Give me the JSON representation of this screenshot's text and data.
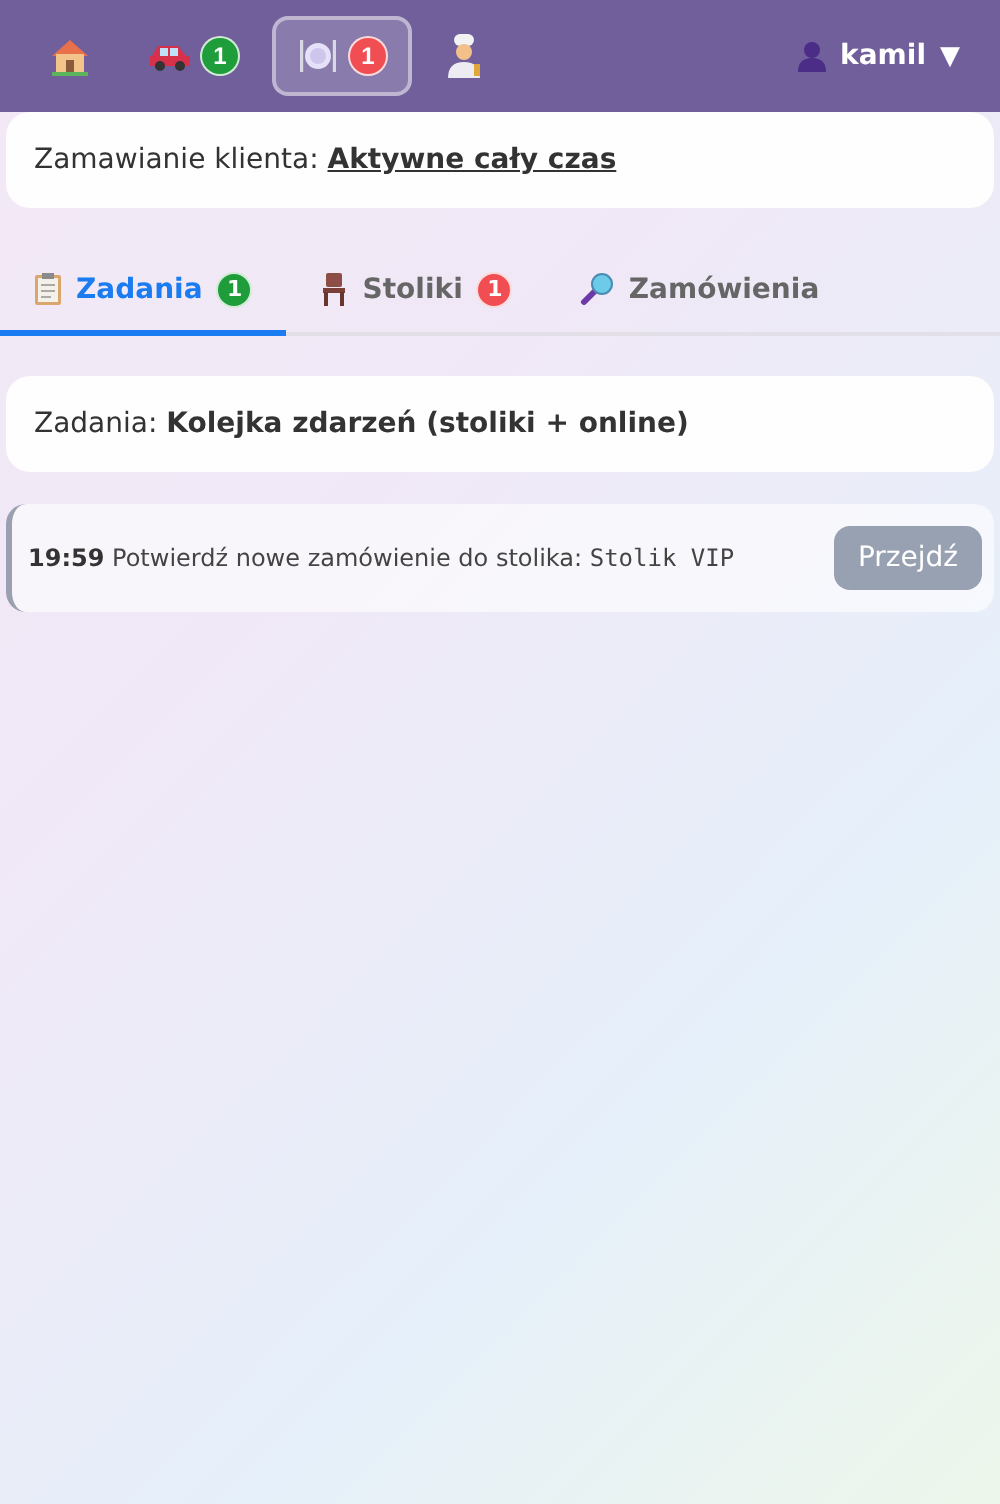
{
  "nav": {
    "items": [
      {
        "kind": "house",
        "selected": false
      },
      {
        "kind": "car",
        "selected": false,
        "badge": {
          "text": "1",
          "color": "#1f9d3a"
        }
      },
      {
        "kind": "plate",
        "selected": true,
        "badge": {
          "text": "1",
          "color": "#f04e52"
        }
      },
      {
        "kind": "chef",
        "selected": false
      }
    ],
    "user": "kamil",
    "caret": "▼"
  },
  "client_ordering": {
    "label": "Zamawianie klienta:",
    "value": "Aktywne cały czas"
  },
  "tabs": [
    {
      "kind": "clipboard",
      "label": "Zadania",
      "selected": true,
      "badge": {
        "text": "1",
        "color": "#1f9d3a"
      }
    },
    {
      "kind": "chair",
      "label": "Stoliki",
      "selected": false,
      "badge": {
        "text": "1",
        "color": "#f04e52"
      }
    },
    {
      "kind": "magnifier",
      "label": "Zamówienia",
      "selected": false
    }
  ],
  "tasks": {
    "label": "Zadania:",
    "value": "Kolejka zdarzeń (stoliki + online)"
  },
  "events": [
    {
      "time": "19:59",
      "text": "Potwierdź nowe zamówienie do stolika:",
      "table": "Stolik VIP",
      "button": "Przejdź"
    }
  ]
}
